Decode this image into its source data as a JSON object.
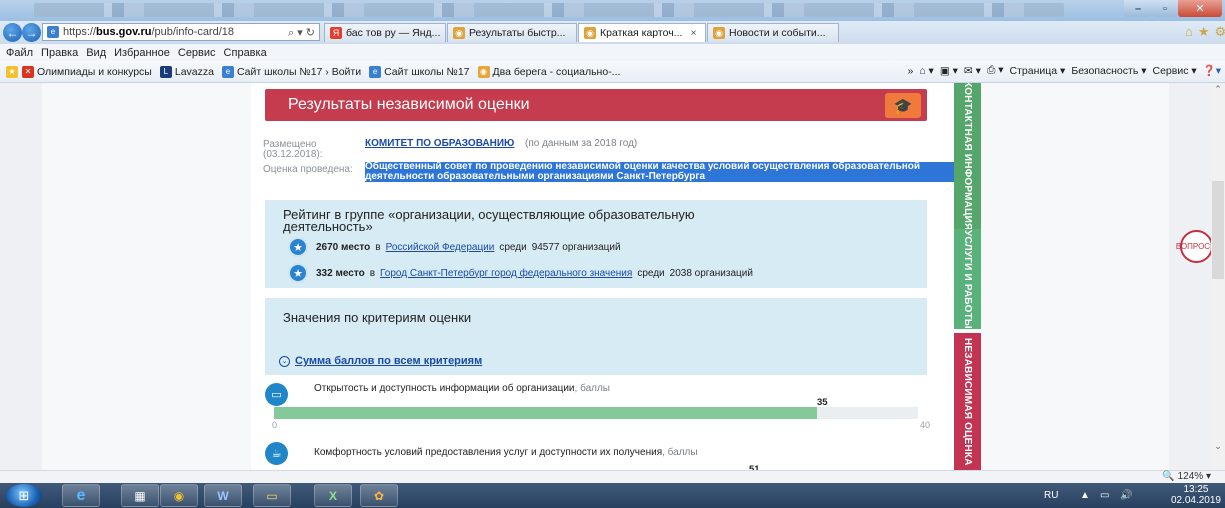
{
  "browser": {
    "address": {
      "prefix": "https://",
      "domain": "bus.gov.ru",
      "path": "/pub/info-card/18",
      "tools": "⌕ ▾ ↻"
    },
    "tabs": [
      {
        "label": "бас тов ру — Янд..."
      },
      {
        "label": "Результаты быстр..."
      },
      {
        "label": "Краткая карточ...",
        "close": "×"
      },
      {
        "label": "Новости и событи..."
      }
    ],
    "menu": [
      "Файл",
      "Правка",
      "Вид",
      "Избранное",
      "Сервис",
      "Справка"
    ],
    "favorites": [
      {
        "label": "Олимпиады и конкурсы"
      },
      {
        "label": "Lavazza"
      },
      {
        "label": "Сайт школы №17 › Войти"
      },
      {
        "label": "Сайт школы №17"
      },
      {
        "label": "Два берега - социально-..."
      }
    ],
    "commands": [
      "Страница ▾",
      "Безопасность ▾",
      "Сервис ▾"
    ],
    "zoom": "124%"
  },
  "page": {
    "header_title": "Результаты независимой оценки",
    "posted_label": "Размещено (03.12.2018):",
    "posted_org": "КОМИТЕТ ПО ОБРАЗОВАНИЮ",
    "posted_note": "(по данным за 2018 год)",
    "assessed_label": "Оценка проведена:",
    "assessor": "Общественный совет по проведению независимой оценки качества условий осуществления образовательной деятельности образовательными организациями Санкт-Петербурга",
    "rating": {
      "title": "Рейтинг в группе «организации, осуществляющие образовательную деятельность»",
      "rows": [
        {
          "place": "2670 место",
          "in": "в",
          "region": "Российской Федерации",
          "among": "среди",
          "count": "94577 организаций"
        },
        {
          "place": "332 место",
          "in": "в",
          "region": "Город Санкт-Петербург город федерального значения",
          "among": "среди",
          "count": "2038 организаций"
        }
      ]
    },
    "criteria": {
      "title": "Значения по критериям оценки",
      "sum_link": "Сумма баллов по всем критериям",
      "items": [
        {
          "label": "Открытость и доступность информации об организации",
          "unit": ", баллы",
          "value": 35,
          "max": 40,
          "min": 0
        },
        {
          "label": "Комфортность условий предоставления услуг и доступности их получения",
          "unit": ", баллы",
          "value": 51
        }
      ]
    },
    "side_tabs": [
      "КОНТАКТНАЯ ИНФОРМАЦИЯ",
      "УСЛУГИ И РАБОТЫ",
      "НЕЗАВИСИМАЯ ОЦЕНКА"
    ],
    "help_text": "ВОПРОСЫ"
  },
  "taskbar": {
    "lang": "RU",
    "time": "13:25",
    "date": "02.04.2019"
  },
  "colors": {
    "header": "#c43c4d",
    "badge": "#f07a3c",
    "panel": "#d7ebf5",
    "bar": "#85c99a",
    "link": "#1a4aa6"
  }
}
